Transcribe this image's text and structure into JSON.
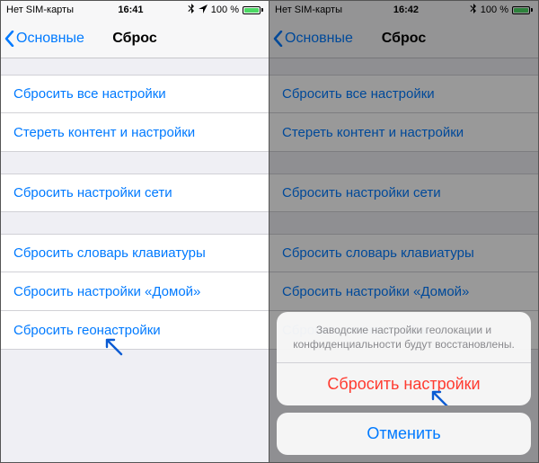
{
  "status": {
    "carrier": "Нет SIM-карты",
    "time": "16:41",
    "battery": "100 %"
  },
  "status_r": {
    "carrier": "Нет SIM-карты",
    "time": "16:42",
    "battery": "100 %"
  },
  "nav": {
    "back": "Основные",
    "title": "Сброс"
  },
  "groups": [
    {
      "rows": [
        {
          "label": "Сбросить все настройки"
        },
        {
          "label": "Стереть контент и настройки"
        }
      ]
    },
    {
      "rows": [
        {
          "label": "Сбросить настройки сети"
        }
      ]
    },
    {
      "rows": [
        {
          "label": "Сбросить словарь клавиатуры"
        },
        {
          "label": "Сбросить настройки «Домой»"
        },
        {
          "label": "Сбросить геонастройки"
        }
      ]
    }
  ],
  "sheet": {
    "message": "Заводские настройки геолокации и конфиденциальности будут восстановлены.",
    "destructive": "Сбросить настройки",
    "cancel": "Отменить"
  },
  "colors": {
    "tint": "#007aff",
    "destructive": "#ff3b30",
    "battery_fill": "#4cd964"
  }
}
